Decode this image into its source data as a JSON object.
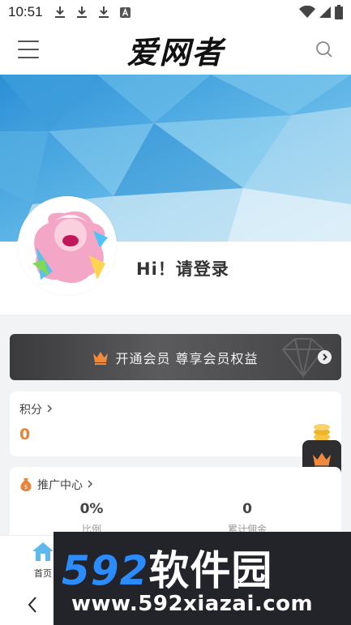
{
  "status_bar": {
    "time": "10:51",
    "left_icons": [
      "download-icon",
      "download-icon",
      "download-icon",
      "font-a-icon"
    ],
    "right_icons": [
      "wifi-icon",
      "signal-icon",
      "battery-icon"
    ]
  },
  "header": {
    "logo_text": "爱网者",
    "menu_icon": "menu-icon",
    "search_icon": "search-icon"
  },
  "profile": {
    "greeting": "Hi！请登录"
  },
  "vip": {
    "label": "开通会员 尊享会员权益",
    "accent": "#f08a3c"
  },
  "points": {
    "title": "积分",
    "value": "0",
    "value_color": "#e8833a"
  },
  "promo": {
    "title": "推广中心",
    "stats": [
      {
        "value": "0%",
        "label": "比例"
      },
      {
        "value": "0",
        "label": "累计佣金"
      }
    ]
  },
  "bottom_nav": {
    "home_label": "首页"
  },
  "watermark": {
    "brand_num": "592",
    "brand_cn": "软件园",
    "url": "www.592xiazai.com"
  }
}
